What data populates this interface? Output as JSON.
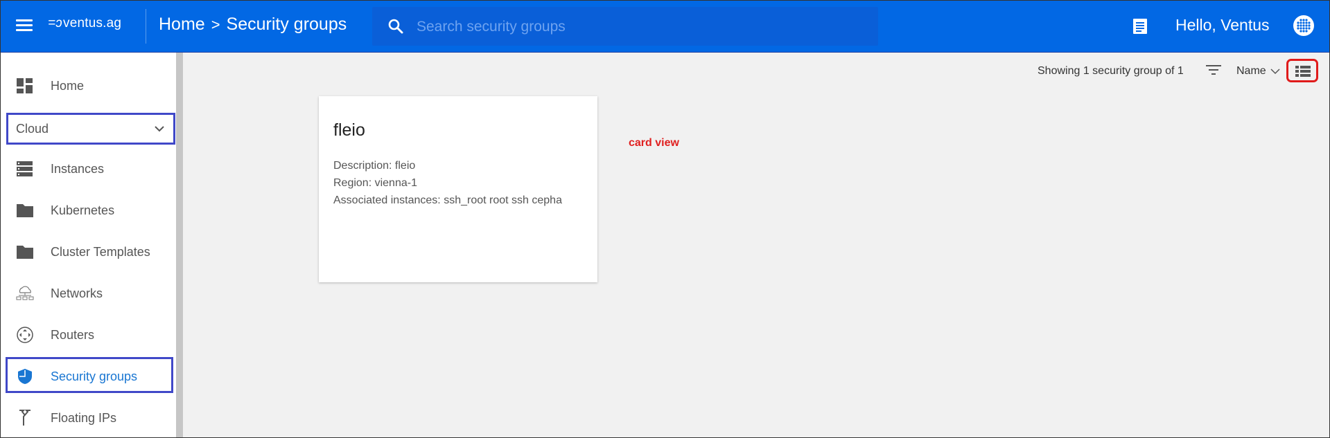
{
  "header": {
    "logo_mark": "=ɔ",
    "logo_text": "ventus.ag",
    "breadcrumb": [
      "Home",
      "Security groups"
    ],
    "breadcrumb_separator": ">",
    "search_placeholder": "Search security groups",
    "greeting": "Hello, Ventus",
    "bar_color": "#0268e4"
  },
  "sidebar": {
    "items": [
      {
        "label": "Home",
        "icon": "dashboard-icon"
      },
      {
        "label": "Cloud",
        "icon": "chevron-down-icon"
      },
      {
        "label": "Instances",
        "icon": "server-icon"
      },
      {
        "label": "Kubernetes",
        "icon": "folder-icon"
      },
      {
        "label": "Cluster Templates",
        "icon": "folder-icon"
      },
      {
        "label": "Networks",
        "icon": "network-cloud-icon"
      },
      {
        "label": "Routers",
        "icon": "router-icon"
      },
      {
        "label": "Security groups",
        "icon": "shield-icon",
        "active": true
      },
      {
        "label": "Floating IPs",
        "icon": "fork-arrow-icon"
      }
    ],
    "active_color": "#1976d2",
    "highlight_color": "#4048c8"
  },
  "toolbar": {
    "showing_text": "Showing 1 security group of 1",
    "sort_label": "Name",
    "view_toggle_highlight": "#e01b1b"
  },
  "cards": [
    {
      "title": "fleio",
      "description": "Description: fleio",
      "region": "Region: vienna-1",
      "instances": "Associated instances: ssh_root root ssh cepha"
    }
  ],
  "annotation": {
    "text": "card view",
    "color": "#e02020"
  }
}
